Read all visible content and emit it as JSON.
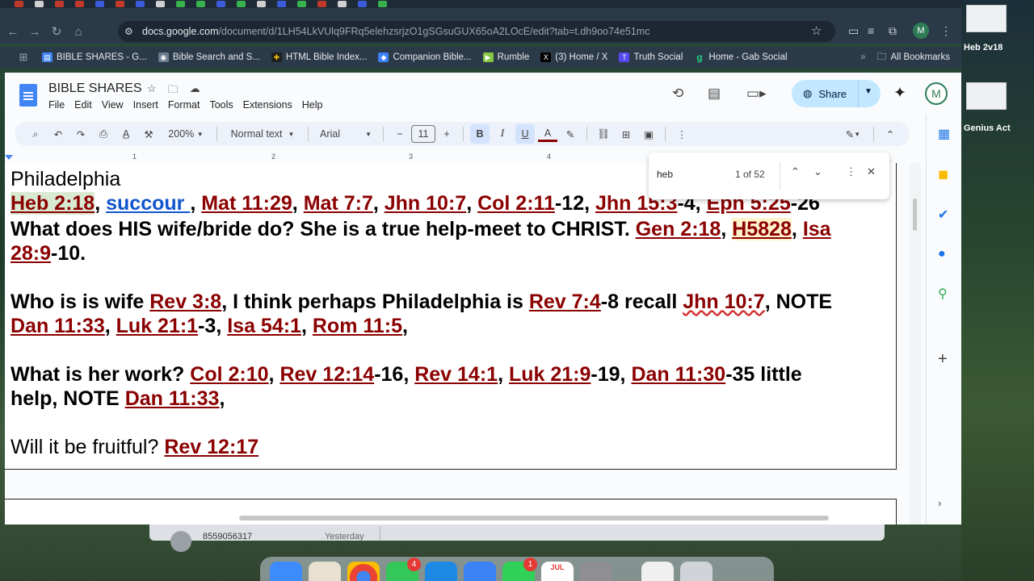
{
  "browser": {
    "url_host": "docs.google.com",
    "url_path": "/document/d/1LH54LkVUlq9FRq5elehzsrjzO1gSGsuGUX65oA2LOcE/edit?tab=t.dh9oo74e51mc",
    "profile_initial": "M",
    "bookmarks": [
      {
        "label": "BIBLE SHARES - G...",
        "color": "#4285f4",
        "glyph": "▤"
      },
      {
        "label": "Bible Search and S...",
        "color": "#6b7c8f",
        "glyph": "◉"
      },
      {
        "label": "HTML Bible Index...",
        "color": "#f1c40f",
        "glyph": "✚"
      },
      {
        "label": "Companion Bible...",
        "color": "#3b82f6",
        "glyph": "◆"
      },
      {
        "label": "Rumble",
        "color": "#85c742",
        "glyph": "▶"
      },
      {
        "label": "(3) Home / X",
        "color": "#000000",
        "glyph": "X"
      },
      {
        "label": "Truth Social",
        "color": "#5448ee",
        "glyph": "T"
      },
      {
        "label": "Home - Gab Social",
        "color": "#21cf7a",
        "glyph": "g"
      }
    ],
    "all_bookmarks": "All Bookmarks"
  },
  "docs": {
    "title": "BIBLE SHARES",
    "menus": [
      "File",
      "Edit",
      "View",
      "Insert",
      "Format",
      "Tools",
      "Extensions",
      "Help"
    ],
    "share_label": "Share",
    "user_initial": "M",
    "toolbar": {
      "zoom": "200%",
      "style": "Normal text",
      "font": "Arial",
      "font_size": "11"
    },
    "ruler": [
      "1",
      "2",
      "3",
      "4"
    ],
    "find": {
      "query": "heb",
      "count": "1 of 52"
    }
  },
  "content": {
    "l1": "Philadelphia",
    "l2": {
      "r1": "Heb 2:18",
      "s1": ", ",
      "r2": "succour ",
      "s2": ", ",
      "r3": "Mat 11:29",
      "s3": ", ",
      "r4": "Mat 7:7",
      "s4": ", ",
      "r5": "Jhn 10:7",
      "s5": ", ",
      "r6": "Col 2:11",
      "s6": "-12, ",
      "r7": "Jhn 15:3",
      "s7": "-4, ",
      "r8": "Eph 5:25",
      "s8": "-26"
    },
    "l3": {
      "t1": "What does HIS wife/bride do? She is a true help-meet to CHRIST. ",
      "r1": "Gen 2:18",
      "s1": ", ",
      "r2": "H5828",
      "s2": ", ",
      "r3": "Isa"
    },
    "l4": {
      "r1": "28:9",
      "s1": "-10."
    },
    "l5": {
      "t1": "Who is is wife ",
      "r1": "Rev 3:8",
      "t2": ",  I think perhaps Philadelphia is ",
      "r2": "Rev 7:4",
      "t3": "-8 recall ",
      "r3": "Jhn 10:7",
      "t4": ", NOTE"
    },
    "l6": {
      "r1": "Dan 11:33",
      "s1": ", ",
      "r2": "Luk 21:1",
      "s2": "-3, ",
      "r3": "Isa 54:1",
      "s3": ", ",
      "r4": "Rom 11:5",
      "s4": ","
    },
    "l7": {
      "t1": "What is her work? ",
      "r1": "Col 2:10",
      "s1": ", ",
      "r2": "Rev 12:14",
      "s2": "-16, ",
      "r3": "Rev 14:1",
      "s3": ", ",
      "r4": "Luk 21:9",
      "s4": "-19, ",
      "r5": "Dan 11:30",
      "s5": "-35 little"
    },
    "l8": {
      "t1": "help, NOTE ",
      "r1": "Dan 11:33",
      "s1": ","
    },
    "l9": {
      "t1": "Will it be fruitful? ",
      "r1": "Rev 12:17"
    }
  },
  "desktop": {
    "behind_window": {
      "phone": "8559056317",
      "when": "Yesterday"
    },
    "thumbs": [
      {
        "label": "Heb 2v18"
      },
      {
        "label": "Genius Act"
      }
    ],
    "dock_badges": [
      "4",
      "1"
    ],
    "calendar_month": "JUL"
  }
}
